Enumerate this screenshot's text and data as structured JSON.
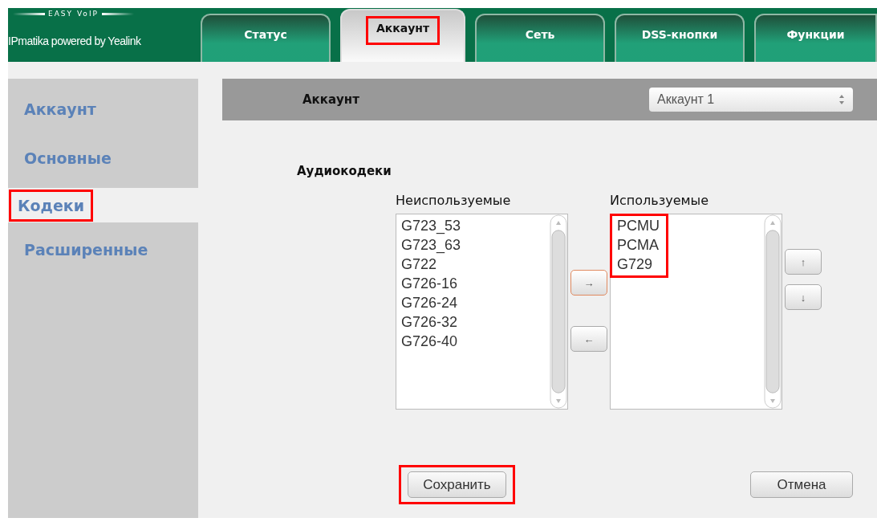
{
  "header": {
    "logo_tagline": "EASY VoIP",
    "brand_text": "IPmatika powered by Yealink"
  },
  "tabs": [
    {
      "label": "Статус",
      "selected": false,
      "highlighted": false
    },
    {
      "label": "Аккаунт",
      "selected": true,
      "highlighted": true
    },
    {
      "label": "Сеть",
      "selected": false,
      "highlighted": false
    },
    {
      "label": "DSS-кнопки",
      "selected": false,
      "highlighted": false
    },
    {
      "label": "Функции",
      "selected": false,
      "highlighted": false
    }
  ],
  "sidebar": {
    "items": [
      {
        "label": "Аккаунт",
        "selected": false,
        "highlighted": false
      },
      {
        "label": "Основные",
        "selected": false,
        "highlighted": false
      },
      {
        "label": "Кодеки",
        "selected": true,
        "highlighted": true
      },
      {
        "label": "Расширенные",
        "selected": false,
        "highlighted": false
      }
    ]
  },
  "account_bar": {
    "label": "Аккаунт",
    "select_value": "Аккаунт 1"
  },
  "section_title": "Аудиокодеки",
  "unused": {
    "label": "Неиспользуемые",
    "items": [
      "G723_53",
      "G723_63",
      "G722",
      "G726-16",
      "G726-24",
      "G726-32",
      "G726-40"
    ],
    "highlighted": false
  },
  "move_buttons": [
    {
      "label": "→",
      "focused": true
    },
    {
      "label": "←",
      "focused": false
    }
  ],
  "used": {
    "label": "Используемые",
    "items": [
      "PCMU",
      "PCMA",
      "G729"
    ],
    "highlighted": true
  },
  "order_buttons": [
    {
      "label": "↑",
      "focused": false
    },
    {
      "label": "↓",
      "focused": false
    }
  ],
  "buttons": [
    {
      "label": "Сохранить",
      "highlighted": true
    },
    {
      "label": "Отмена",
      "highlighted": false
    }
  ]
}
